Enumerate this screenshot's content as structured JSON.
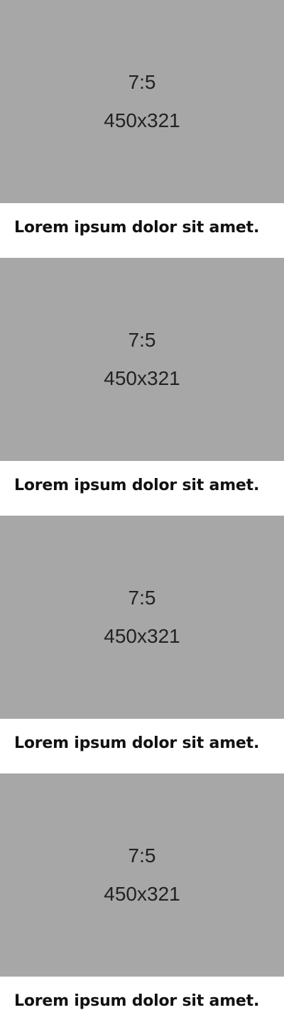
{
  "cards": [
    {
      "ratio": "7:5",
      "size": "450x321",
      "caption": "Lorem ipsum dolor sit amet."
    },
    {
      "ratio": "7:5",
      "size": "450x321",
      "caption": "Lorem ipsum dolor sit amet."
    },
    {
      "ratio": "7:5",
      "size": "450x321",
      "caption": "Lorem ipsum dolor sit amet."
    },
    {
      "ratio": "7:5",
      "size": "450x321",
      "caption": "Lorem ipsum dolor sit amet."
    }
  ],
  "colors": {
    "placeholder_bg": "#a7a7a7",
    "text": "#111111"
  }
}
